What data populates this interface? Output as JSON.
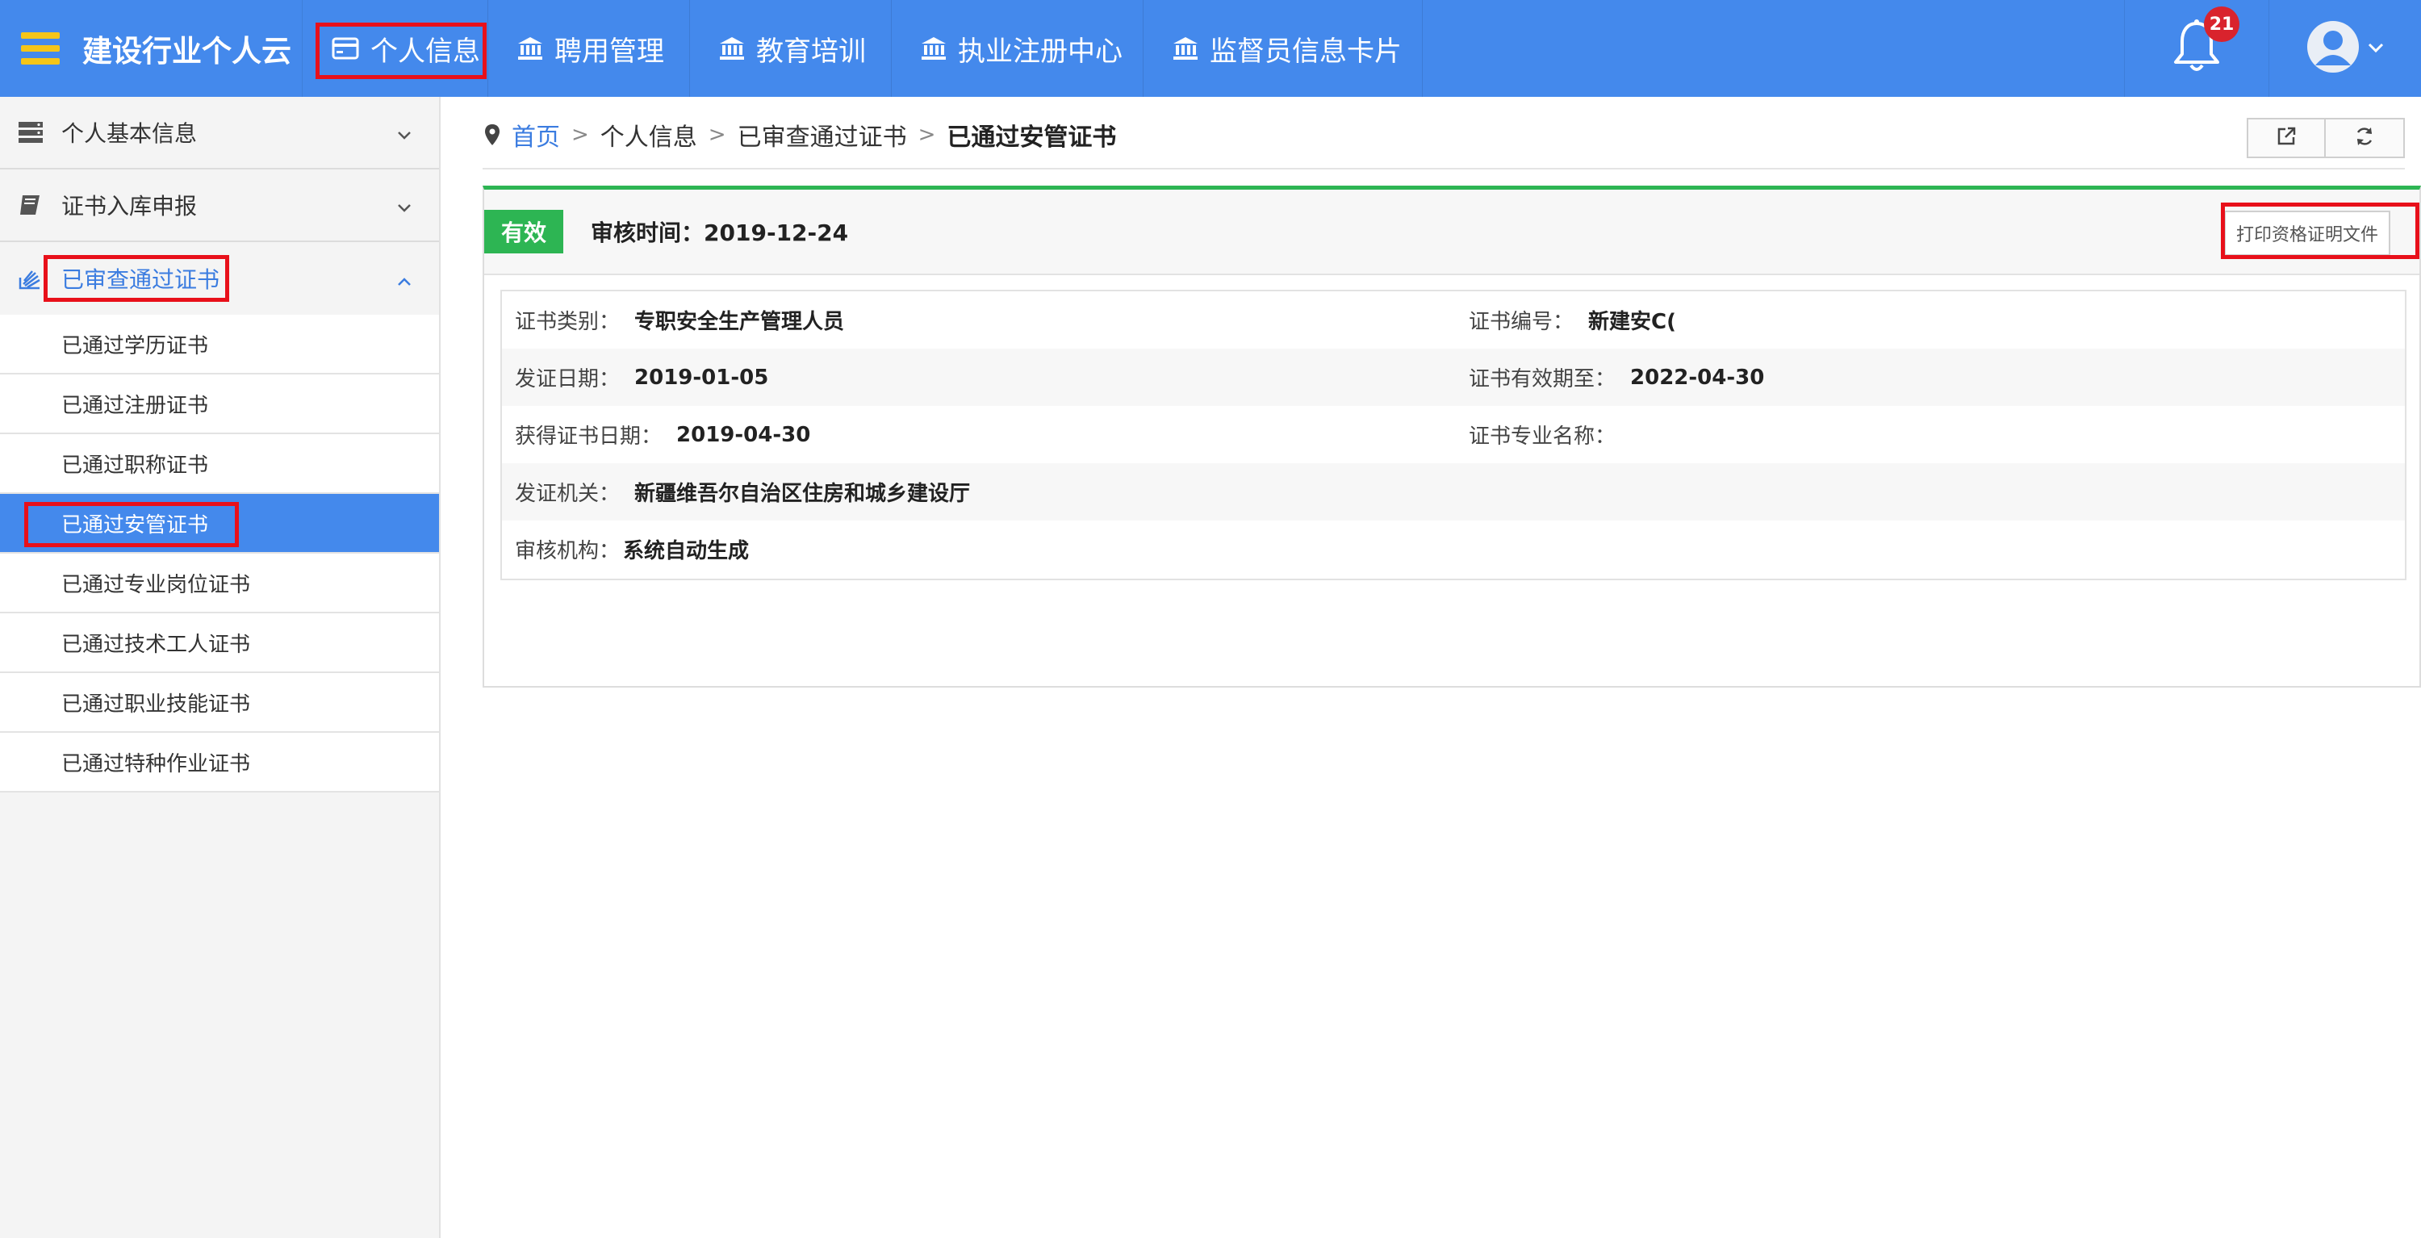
{
  "app": {
    "title": "建设行业个人云"
  },
  "nav": [
    {
      "label": "个人信息",
      "icon": "card-icon"
    },
    {
      "label": "聘用管理",
      "icon": "bank-icon"
    },
    {
      "label": "教育培训",
      "icon": "bank-icon"
    },
    {
      "label": "执业注册中心",
      "icon": "bank-icon"
    },
    {
      "label": "监督员信息卡片",
      "icon": "bank-icon"
    }
  ],
  "notifications": {
    "count": "21"
  },
  "sidebar": {
    "groups": [
      {
        "label": "个人基本信息",
        "icon": "server-icon"
      },
      {
        "label": "证书入库申报",
        "icon": "book-icon"
      },
      {
        "label": "已审查通过证书",
        "icon": "stack-icon"
      }
    ],
    "subitems": [
      {
        "label": "已通过学历证书"
      },
      {
        "label": "已通过注册证书"
      },
      {
        "label": "已通过职称证书"
      },
      {
        "label": "已通过安管证书"
      },
      {
        "label": "已通过专业岗位证书"
      },
      {
        "label": "已通过技术工人证书"
      },
      {
        "label": "已通过职业技能证书"
      },
      {
        "label": "已通过特种作业证书"
      }
    ]
  },
  "breadcrumb": {
    "home": "首页",
    "level1": "个人信息",
    "level2": "已审查通过证书",
    "current": "已通过安管证书"
  },
  "panel": {
    "status": "有效",
    "review_time_label": "审核时间：",
    "review_time": "2019-12-24",
    "print_label": "打印资格证明文件",
    "fields": {
      "cert_type_label": "证书类别：",
      "cert_type": "专职安全生产管理人员",
      "cert_no_label": "证书编号：",
      "cert_no": "新建安C(",
      "issue_date_label": "发证日期：",
      "issue_date": "2019-01-05",
      "valid_until_label": "证书有效期至：",
      "valid_until": "2022-04-30",
      "obtain_date_label": "获得证书日期：",
      "obtain_date": "2019-04-30",
      "specialty_label": "证书专业名称：",
      "specialty": "",
      "issuer_label": "发证机关：",
      "issuer": "新疆维吾尔自治区住房和城乡建设厅",
      "reviewer_label": "审核机构：",
      "reviewer": "系统自动生成"
    }
  },
  "colors": {
    "topbar": "#4489ec",
    "accent_green": "#2db553",
    "highlight_red": "#e8101a",
    "badge_red": "#d9232d",
    "hamburger_yellow": "#f5c518"
  }
}
